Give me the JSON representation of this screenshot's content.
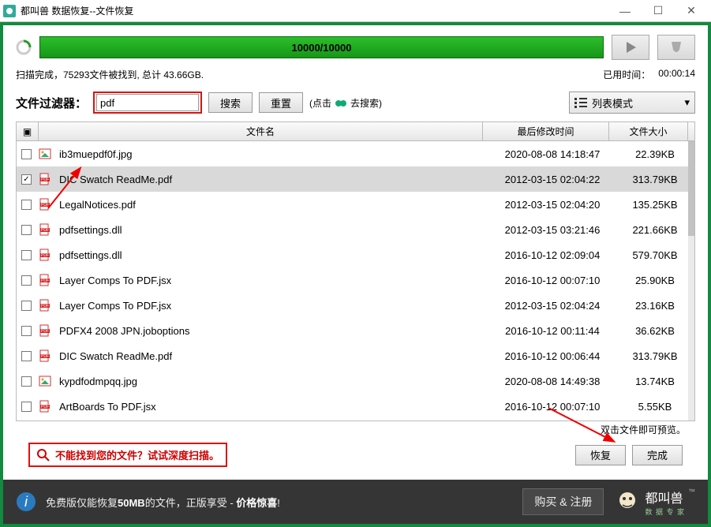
{
  "window": {
    "title": "都叫兽 数据恢复--文件恢复"
  },
  "progress": {
    "text": "10000/10000"
  },
  "status": {
    "left": "扫描完成，75293文件被找到, 总计 43.66GB.",
    "elapsed_label": "已用时间：",
    "elapsed_value": "00:00:14"
  },
  "filter": {
    "label": "文件过滤器：",
    "value": "pdf",
    "search_btn": "搜索",
    "reset_btn": "重置",
    "hint_prefix": "(点击",
    "hint_suffix": "去搜索)"
  },
  "view_mode": {
    "label": "列表模式"
  },
  "table": {
    "headers": {
      "check": "▣",
      "name": "文件名",
      "date": "最后修改时间",
      "size": "文件大小"
    },
    "rows": [
      {
        "checked": false,
        "icon": "img",
        "name": "ib3muepdf0f.jpg",
        "date": "2020-08-08 14:18:47",
        "size": "22.39KB",
        "selected": false
      },
      {
        "checked": true,
        "icon": "pdf",
        "name": "DIC Swatch ReadMe.pdf",
        "date": "2012-03-15 02:04:22",
        "size": "313.79KB",
        "selected": true
      },
      {
        "checked": false,
        "icon": "pdf",
        "name": "LegalNotices.pdf",
        "date": "2012-03-15 02:04:20",
        "size": "135.25KB",
        "selected": false
      },
      {
        "checked": false,
        "icon": "pdf",
        "name": "pdfsettings.dll",
        "date": "2012-03-15 03:21:46",
        "size": "221.66KB",
        "selected": false
      },
      {
        "checked": false,
        "icon": "pdf",
        "name": "pdfsettings.dll",
        "date": "2016-10-12 02:09:04",
        "size": "579.70KB",
        "selected": false
      },
      {
        "checked": false,
        "icon": "pdf",
        "name": "Layer Comps To PDF.jsx",
        "date": "2016-10-12 00:07:10",
        "size": "25.90KB",
        "selected": false
      },
      {
        "checked": false,
        "icon": "pdf",
        "name": "Layer Comps To PDF.jsx",
        "date": "2012-03-15 02:04:24",
        "size": "23.16KB",
        "selected": false
      },
      {
        "checked": false,
        "icon": "pdf",
        "name": "PDFX4 2008 JPN.joboptions",
        "date": "2016-10-12 00:11:44",
        "size": "36.62KB",
        "selected": false
      },
      {
        "checked": false,
        "icon": "pdf",
        "name": "DIC Swatch ReadMe.pdf",
        "date": "2016-10-12 00:06:44",
        "size": "313.79KB",
        "selected": false
      },
      {
        "checked": false,
        "icon": "img",
        "name": "kypdfodmpqq.jpg",
        "date": "2020-08-08 14:49:38",
        "size": "13.74KB",
        "selected": false
      },
      {
        "checked": false,
        "icon": "pdf",
        "name": "ArtBoards To PDF.jsx",
        "date": "2016-10-12 00:07:10",
        "size": "5.55KB",
        "selected": false
      }
    ],
    "footer_hint": "双击文件即可预览。"
  },
  "bottom": {
    "deep_scan_label": "不能找到您的文件？试试深度扫描。",
    "recover_btn": "恢复",
    "done_btn": "完成"
  },
  "upsell": {
    "text_prefix": "免费版仅能恢复",
    "text_size": "50MB",
    "text_mid": "的文件，正版享受 - ",
    "text_highlight": "价格惊喜",
    "text_suffix": "!",
    "buy_btn": "购买 & 注册",
    "brand_name": "都叫兽",
    "brand_sub": "数 据 专 家"
  }
}
